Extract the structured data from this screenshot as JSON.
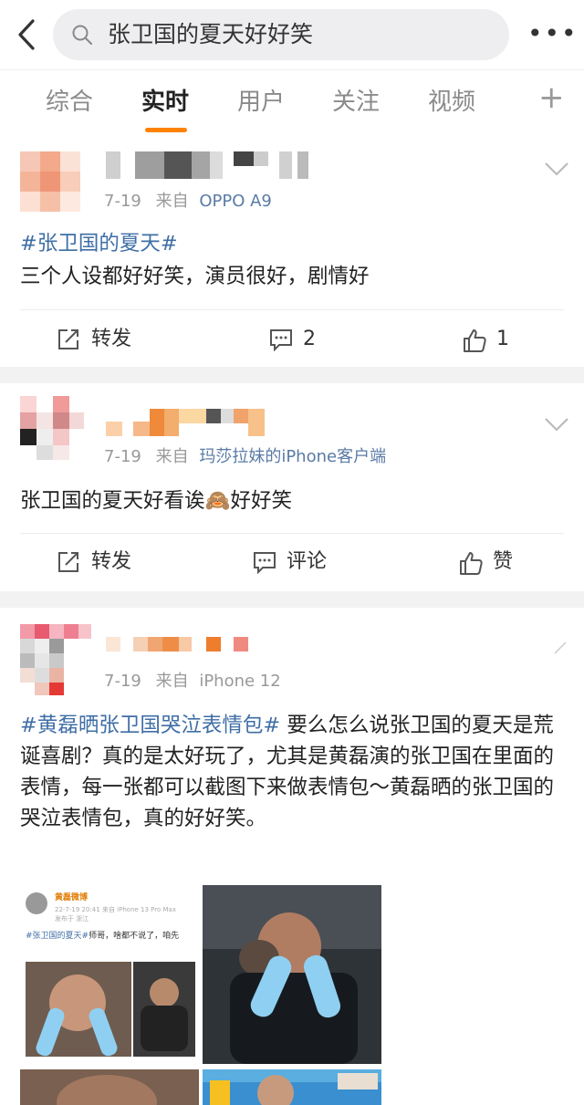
{
  "search": {
    "query": "张卫国的夏天好好笑"
  },
  "tabs": [
    {
      "label": "综合"
    },
    {
      "label": "实时",
      "active": true
    },
    {
      "label": "用户"
    },
    {
      "label": "关注"
    },
    {
      "label": "视频"
    }
  ],
  "tabs_extra": "+",
  "accent_color": "#ff8200",
  "topic_color": "#3f6ea6",
  "posts": [
    {
      "date": "7-19",
      "from_label": "来自",
      "source": "OPPO A9",
      "topic": "#张卫国的夏天#",
      "body": "三个人设都好好笑，演员很好，剧情好",
      "actions": {
        "repost": "转发",
        "comment": "2",
        "like": "1"
      }
    },
    {
      "date": "7-19",
      "from_label": "来自",
      "source": "玛莎拉妹的iPhone客户端",
      "body_before": "张卫国的夏天好看诶",
      "emoji": "🙈",
      "body_after": "好好笑",
      "actions": {
        "repost": "转发",
        "comment": "评论",
        "like": "赞"
      }
    },
    {
      "date": "7-19",
      "from_label": "来自",
      "source": "iPhone 12",
      "topic": "#黄磊晒张卫国哭泣表情包#",
      "body": " 要么怎么说张卫国的夏天是荒诞喜剧？真的是太好玩了，尤其是黄磊演的张卫国在里面的表情，每一张都可以截图下来做表情包～黄磊晒的张卫国的哭泣表情包，真的好好笑。",
      "embedded_post": {
        "author": "黄磊微博",
        "time": "22-7-19 20:41",
        "device": "来自 iPhone 13 Pro Max",
        "location": "发布于 浙江",
        "topic": "#张卫国的夏天#",
        "text": "师哥，啥都不说了，咱先"
      }
    }
  ]
}
